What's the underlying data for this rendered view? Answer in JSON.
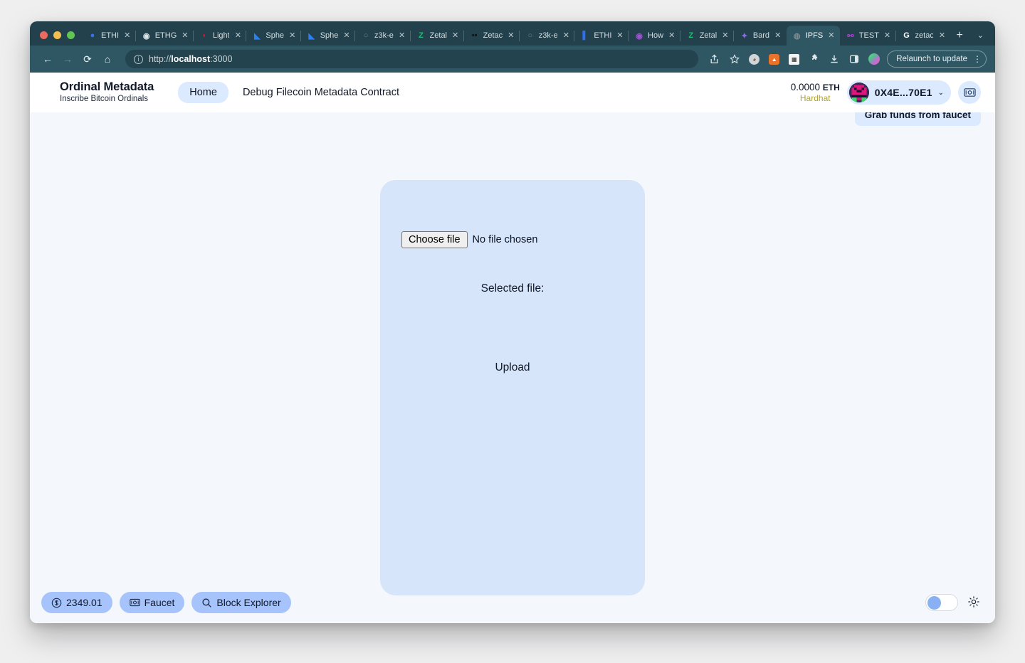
{
  "browser": {
    "tabs": [
      {
        "title": "ETHI",
        "favicon_color": "#3b6ef0",
        "favicon_glyph": "●",
        "active": false
      },
      {
        "title": "ETHG",
        "favicon_color": "#dde3e6",
        "favicon_glyph": "◉",
        "active": false
      },
      {
        "title": "Light",
        "favicon_color": "#c4203f",
        "favicon_glyph": "◗",
        "active": false
      },
      {
        "title": "Sphe",
        "favicon_color": "#2f7ff0",
        "favicon_glyph": "◣",
        "active": false
      },
      {
        "title": "Sphe",
        "favicon_color": "#2f7ff0",
        "favicon_glyph": "◣",
        "active": false
      },
      {
        "title": "z3k-e",
        "favicon_color": "#6b838c",
        "favicon_glyph": "○",
        "active": false
      },
      {
        "title": "Zetal",
        "favicon_color": "#1fbf72",
        "favicon_glyph": "Z",
        "active": false
      },
      {
        "title": "Zetac",
        "favicon_color": "#111111",
        "favicon_glyph": "••",
        "active": false
      },
      {
        "title": "z3k-e",
        "favicon_color": "#6b838c",
        "favicon_glyph": "○",
        "active": false
      },
      {
        "title": "ETHI",
        "favicon_color": "#2f6ef0",
        "favicon_glyph": "▌",
        "active": false
      },
      {
        "title": "How",
        "favicon_color": "#a24fd6",
        "favicon_glyph": "◉",
        "active": false
      },
      {
        "title": "Zetal",
        "favicon_color": "#1fbf72",
        "favicon_glyph": "Z",
        "active": false
      },
      {
        "title": "Bard",
        "favicon_color": "#8b6ce8",
        "favicon_glyph": "✦",
        "active": false
      },
      {
        "title": "IPFS",
        "favicon_color": "#7c8b91",
        "favicon_glyph": "◍",
        "active": true
      },
      {
        "title": "TEST",
        "favicon_color": "#b03fd6",
        "favicon_glyph": "⚯",
        "active": false
      },
      {
        "title": "zetac",
        "favicon_color": "#ffffff",
        "favicon_glyph": "G",
        "active": false
      }
    ],
    "tab_close_glyph": "✕",
    "new_tab_glyph": "+",
    "tab_list_chevron": "⌄",
    "nav": {
      "back": "←",
      "forward": "→",
      "reload": "⟳",
      "home": "⌂"
    },
    "omnibox": {
      "info_glyph": "ⓘ",
      "url_prefix": "http://",
      "url_host": "localhost",
      "url_suffix": ":3000"
    },
    "toolbar_icons": [
      "share-icon",
      "bookmark-star-icon",
      "extension-puzzle-icon",
      "download-icon",
      "side-panel-icon",
      "profile-avatar-icon"
    ],
    "relaunch_label": "Relaunch to update",
    "kebab_glyph": "⋮"
  },
  "app": {
    "brand": {
      "title": "Ordinal Metadata",
      "subtitle": "Inscribe Bitcoin Ordinals"
    },
    "nav": [
      {
        "label": "Home",
        "active": true
      },
      {
        "label": "Debug Filecoin Metadata Contract",
        "active": false
      }
    ],
    "wallet": {
      "balance": "0.0000",
      "currency": "ETH",
      "network": "Hardhat",
      "address": "0X4E...70E1",
      "chevron": "⌄"
    },
    "tooltip": "Grab funds from faucet",
    "card": {
      "choose_file_label": "Choose file",
      "no_file_text": "No file chosen",
      "selected_file_label": "Selected file:",
      "upload_label": "Upload"
    },
    "bottom_bar": {
      "price": "2349.01",
      "faucet_label": "Faucet",
      "block_explorer_label": "Block Explorer"
    },
    "colors": {
      "accent": "#dbeafe",
      "pill": "#a6c4fb",
      "card": "#d7e5fb",
      "page_bg": "#f4f8fd",
      "network": "#b0a436"
    }
  }
}
